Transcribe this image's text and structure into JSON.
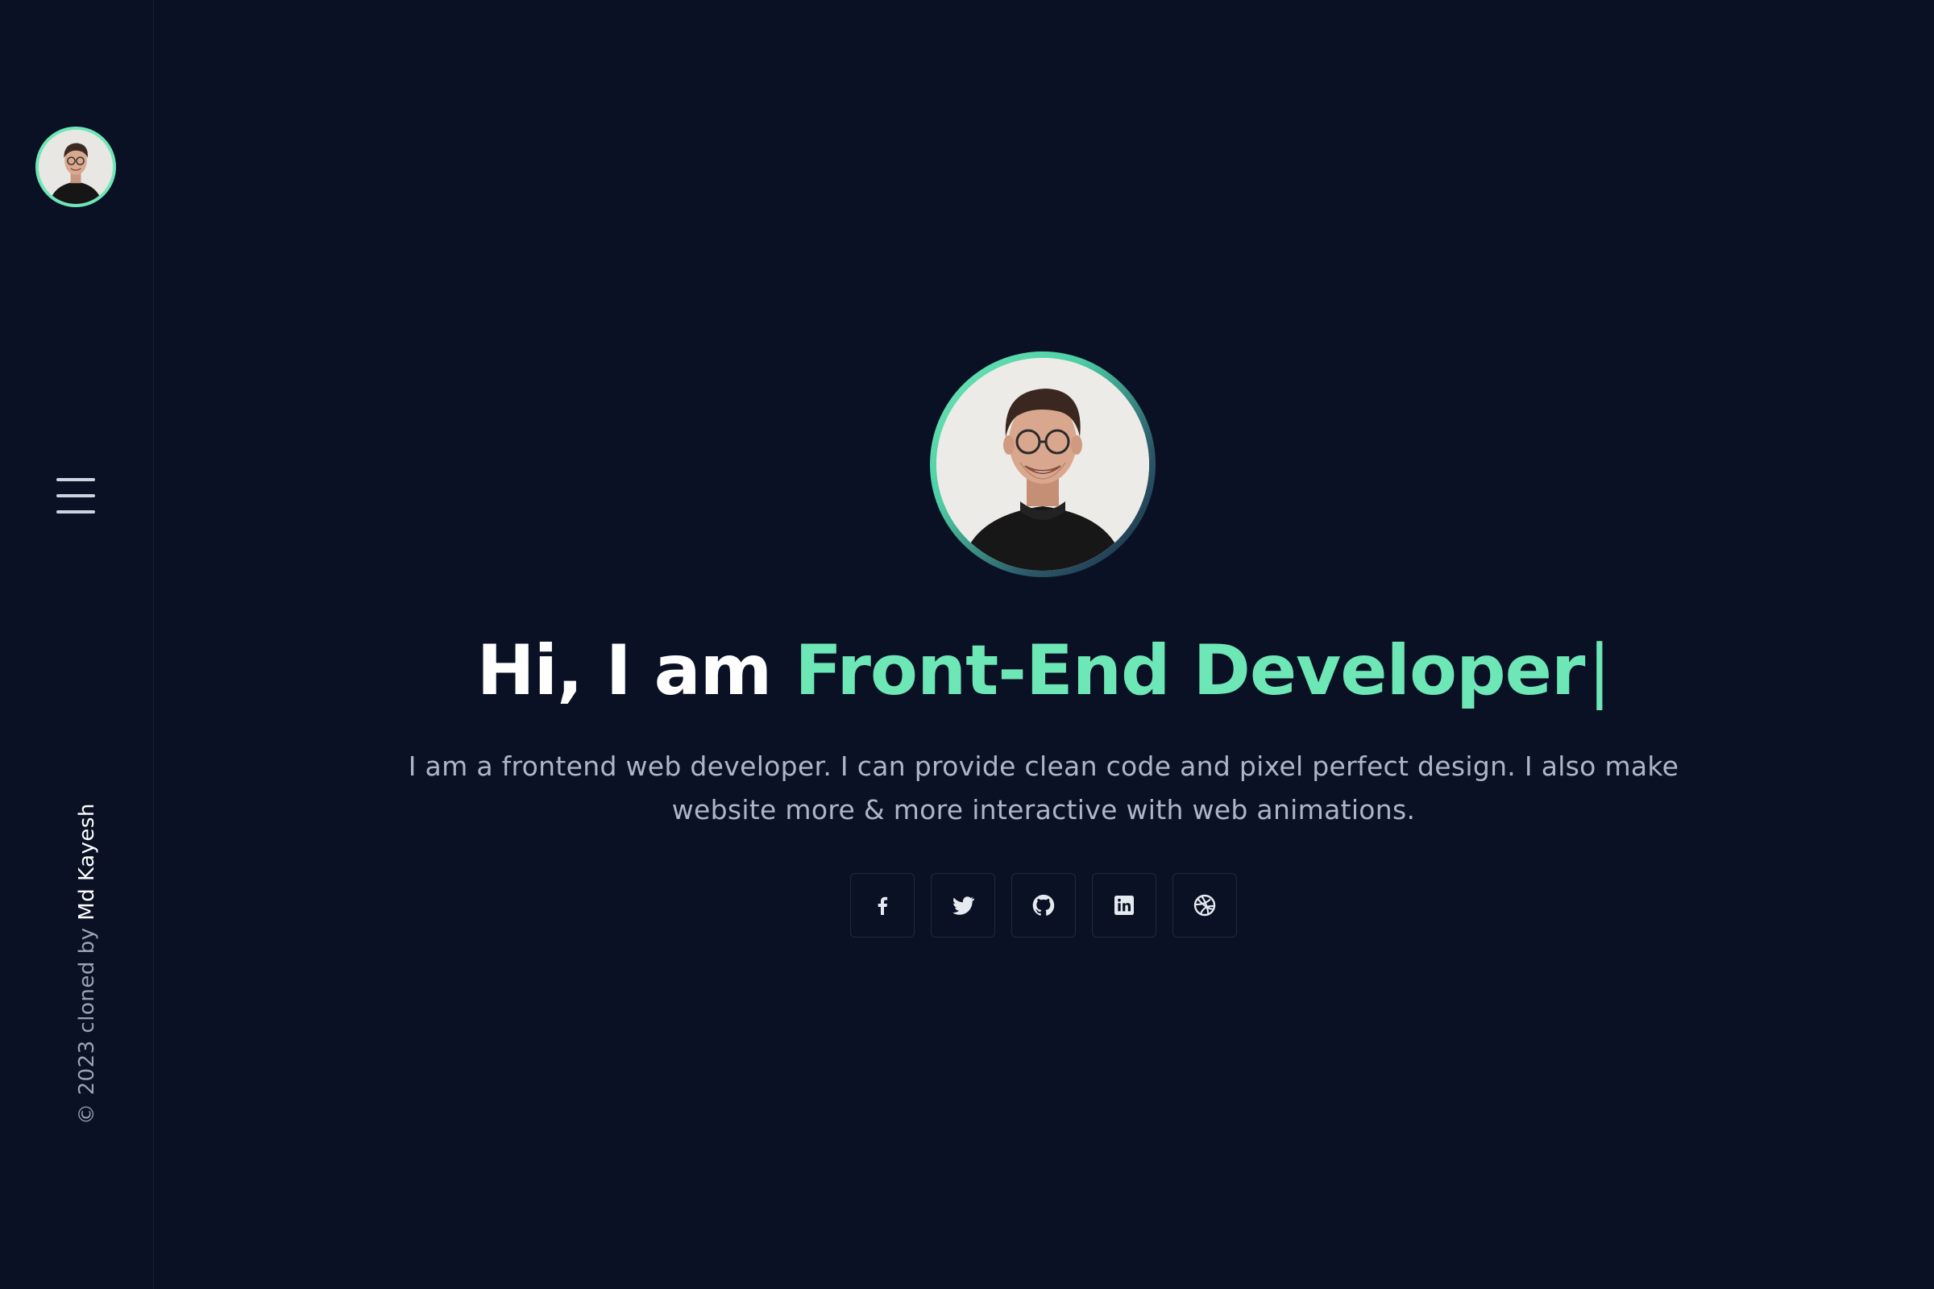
{
  "sidebar": {
    "avatar_alt": "Profile photo",
    "copyright": {
      "symbol": "©",
      "text": "2023 cloned by",
      "author": "Md Kayesh"
    }
  },
  "hero": {
    "greeting": "Hi, I am",
    "role": "Front-End Developer",
    "cursor": "|",
    "description": "I am a frontend web developer. I can provide clean code and pixel perfect design. I also make website more & more interactive with web animations."
  },
  "socials": [
    {
      "name": "facebook",
      "icon": "facebook-icon"
    },
    {
      "name": "twitter",
      "icon": "twitter-icon"
    },
    {
      "name": "github",
      "icon": "github-icon"
    },
    {
      "name": "linkedin",
      "icon": "linkedin-icon"
    },
    {
      "name": "dribbble",
      "icon": "dribbble-icon"
    }
  ],
  "colors": {
    "background": "#0b1124",
    "accent": "#6ee7b7",
    "text": "#ffffff",
    "muted": "#aeb6c6"
  }
}
